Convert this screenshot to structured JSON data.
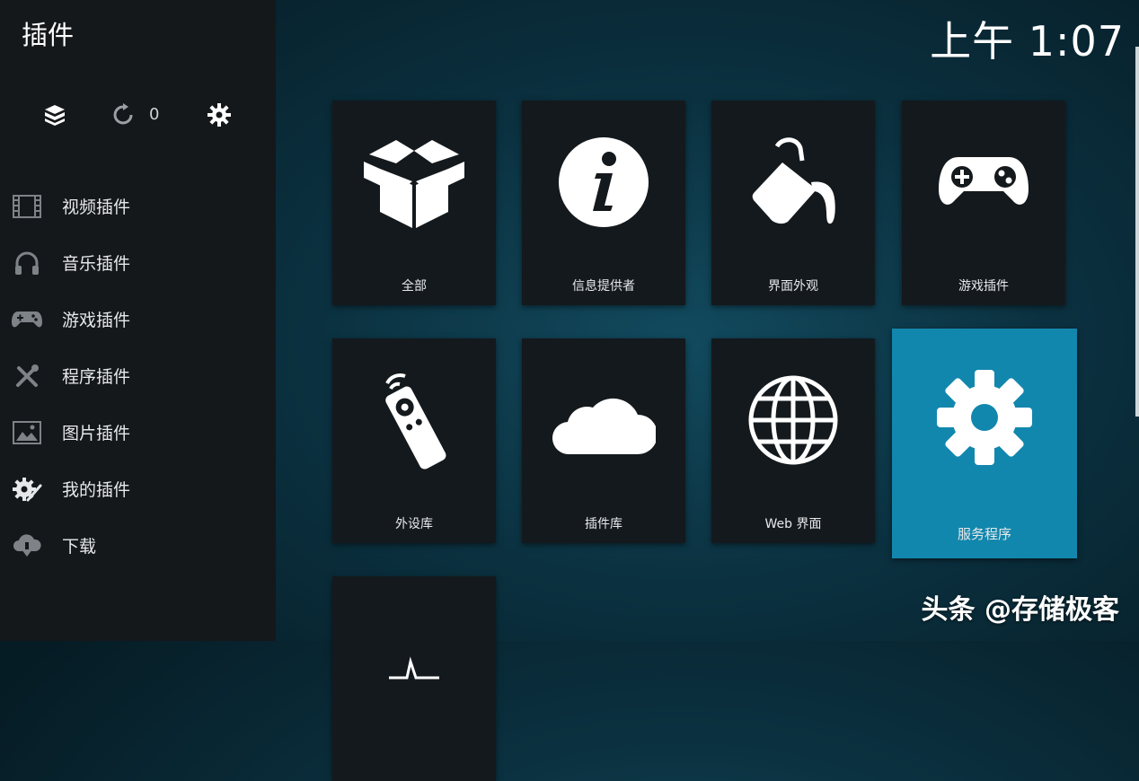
{
  "app": {
    "title": "插件",
    "clock": "上午 1:07"
  },
  "toolbar": {
    "icons": [
      "addon-box-icon",
      "refresh-icon",
      "gear-icon"
    ],
    "update_count": "0"
  },
  "sidebar": {
    "items": [
      {
        "label": "视频插件",
        "icon": "film-icon"
      },
      {
        "label": "音乐插件",
        "icon": "headphones-icon"
      },
      {
        "label": "游戏插件",
        "icon": "gamepad-icon"
      },
      {
        "label": "程序插件",
        "icon": "tools-icon"
      },
      {
        "label": "图片插件",
        "icon": "picture-icon"
      },
      {
        "label": "我的插件",
        "icon": "addon-gear-icon"
      },
      {
        "label": "下载",
        "icon": "cloud-download-icon"
      }
    ]
  },
  "grid": {
    "tiles": [
      {
        "label": "全部",
        "icon": "open-box-icon"
      },
      {
        "label": "信息提供者",
        "icon": "info-icon"
      },
      {
        "label": "界面外观",
        "icon": "paint-bucket-icon"
      },
      {
        "label": "游戏插件",
        "icon": "gamepad-icon"
      },
      {
        "label": "外设库",
        "icon": "remote-control-icon"
      },
      {
        "label": "插件库",
        "icon": "cloud-icon"
      },
      {
        "label": "Web 界面",
        "icon": "globe-icon"
      },
      {
        "label": "服务程序",
        "icon": "gear-icon",
        "focused": true
      },
      {
        "label": "",
        "icon": "waveform-icon"
      }
    ]
  },
  "watermark": "头条 @存储极客",
  "colors": {
    "sidebar_bg": "#15181b",
    "tile_bg": "#14191d",
    "focus_accent": "#1287ad"
  }
}
